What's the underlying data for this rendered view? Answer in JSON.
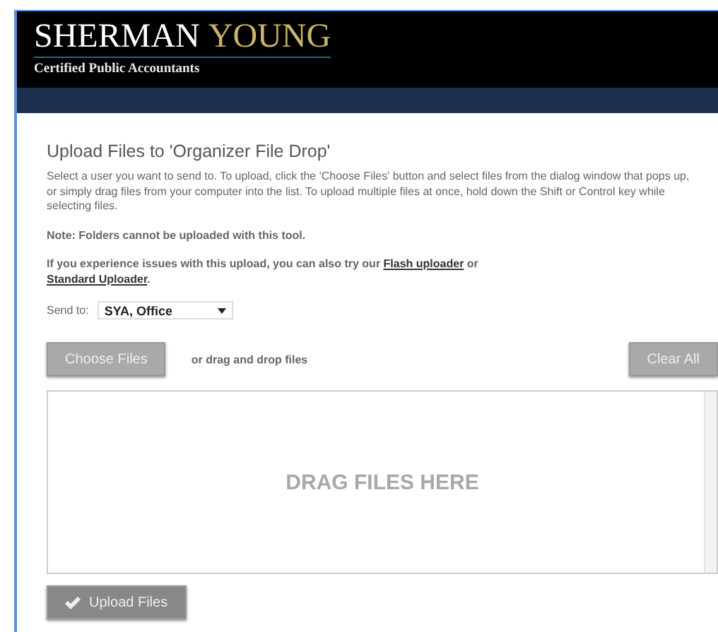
{
  "header": {
    "brand_first": "SHERMAN",
    "brand_second": "YOUNG",
    "tagline": "Certified Public Accountants"
  },
  "title": "Upload Files to 'Organizer File Drop'",
  "instructions": "Select a user you want to send to. To upload, click the 'Choose Files' button and select files from the dialog window that pops up, or simply drag files from your computer into the list. To upload multiple files at once, hold down the Shift or Control key while selecting files.",
  "note": "Note: Folders cannot be uploaded with this tool.",
  "alternatives": {
    "before": "If you experience issues with this upload, you can also try our ",
    "link_1": "Flash uploader",
    "between": " or ",
    "link_2": "Standard Uploader",
    "after": "."
  },
  "send_to": {
    "label": "Send to:",
    "value": "SYA, Office"
  },
  "choose_button": "Choose Files",
  "drag_hint": "or drag and drop files",
  "clear_button": "Clear All",
  "drop_zone": {
    "placeholder": "DRAG FILES HERE"
  },
  "upload_button": "Upload Files"
}
